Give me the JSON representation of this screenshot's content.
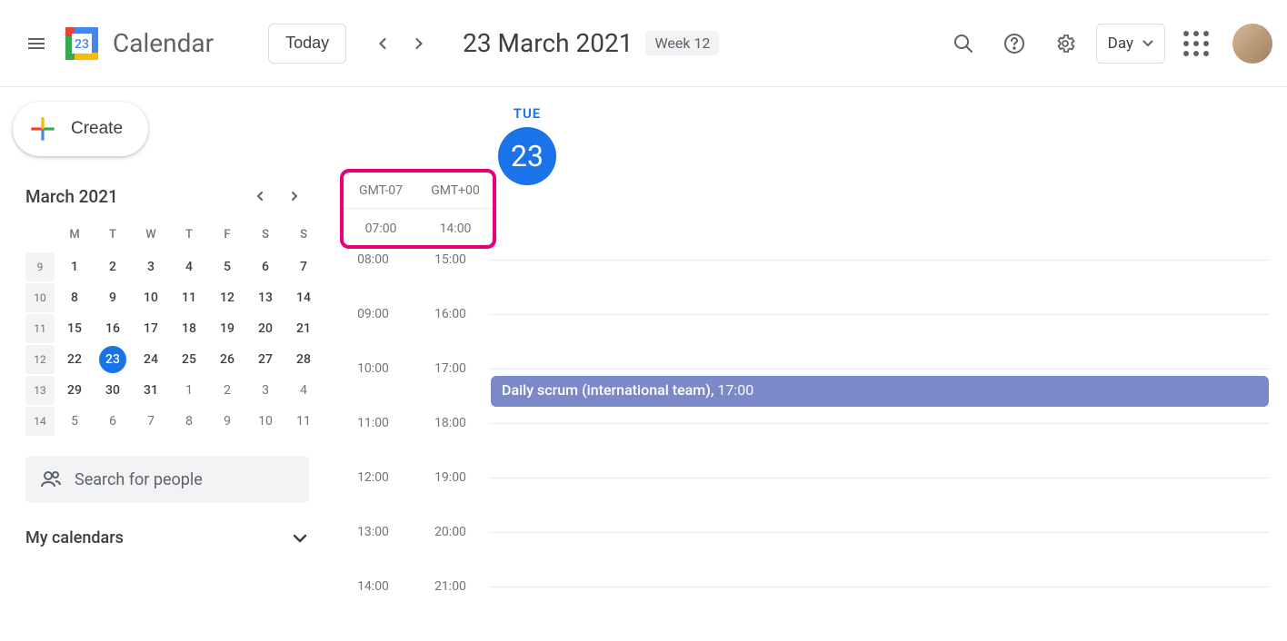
{
  "header": {
    "app_name": "Calendar",
    "today_label": "Today",
    "date_title": "23 March 2021",
    "week_badge": "Week 12",
    "view_label": "Day"
  },
  "sidebar": {
    "create_label": "Create",
    "mini_cal_title": "March 2021",
    "dow": [
      "M",
      "T",
      "W",
      "T",
      "F",
      "S",
      "S"
    ],
    "weeks": [
      {
        "num": "9",
        "days": [
          {
            "d": "1"
          },
          {
            "d": "2"
          },
          {
            "d": "3"
          },
          {
            "d": "4"
          },
          {
            "d": "5"
          },
          {
            "d": "6"
          },
          {
            "d": "7"
          }
        ]
      },
      {
        "num": "10",
        "days": [
          {
            "d": "8"
          },
          {
            "d": "9"
          },
          {
            "d": "10"
          },
          {
            "d": "11"
          },
          {
            "d": "12"
          },
          {
            "d": "13"
          },
          {
            "d": "14"
          }
        ]
      },
      {
        "num": "11",
        "days": [
          {
            "d": "15"
          },
          {
            "d": "16"
          },
          {
            "d": "17"
          },
          {
            "d": "18"
          },
          {
            "d": "19"
          },
          {
            "d": "20"
          },
          {
            "d": "21"
          }
        ]
      },
      {
        "num": "12",
        "days": [
          {
            "d": "22"
          },
          {
            "d": "23",
            "today": true
          },
          {
            "d": "24"
          },
          {
            "d": "25"
          },
          {
            "d": "26"
          },
          {
            "d": "27"
          },
          {
            "d": "28"
          }
        ]
      },
      {
        "num": "13",
        "days": [
          {
            "d": "29"
          },
          {
            "d": "30"
          },
          {
            "d": "31"
          },
          {
            "d": "1",
            "other": true
          },
          {
            "d": "2",
            "other": true
          },
          {
            "d": "3",
            "other": true
          },
          {
            "d": "4",
            "other": true
          }
        ]
      },
      {
        "num": "14",
        "days": [
          {
            "d": "5",
            "other": true
          },
          {
            "d": "6",
            "other": true
          },
          {
            "d": "7",
            "other": true
          },
          {
            "d": "8",
            "other": true
          },
          {
            "d": "9",
            "other": true
          },
          {
            "d": "10",
            "other": true
          },
          {
            "d": "11",
            "other": true
          }
        ]
      }
    ],
    "search_placeholder": "Search for people",
    "my_calendars_label": "My calendars"
  },
  "day_view": {
    "dow_label": "TUE",
    "day_num": "23",
    "tz1_label": "GMT-07",
    "tz2_label": "GMT+00",
    "hours": [
      {
        "t1": "07:00",
        "t2": "14:00"
      },
      {
        "t1": "08:00",
        "t2": "15:00"
      },
      {
        "t1": "09:00",
        "t2": "16:00"
      },
      {
        "t1": "10:00",
        "t2": "17:00"
      },
      {
        "t1": "11:00",
        "t2": "18:00"
      },
      {
        "t1": "12:00",
        "t2": "19:00"
      },
      {
        "t1": "13:00",
        "t2": "20:00"
      },
      {
        "t1": "14:00",
        "t2": "21:00"
      }
    ],
    "event": {
      "title": "Daily scrum (international team),",
      "time": "17:00",
      "row": 3
    }
  }
}
